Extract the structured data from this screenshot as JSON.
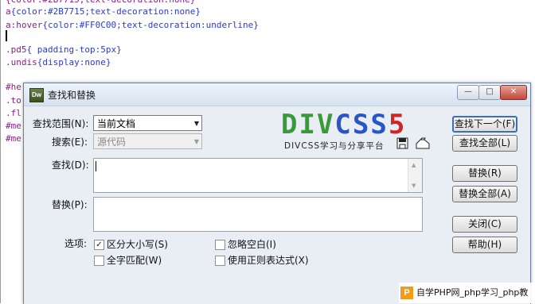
{
  "editor": {
    "lines": [
      {
        "sel": "a",
        "prop": "{color:#2B7715;text-decoration:none}"
      },
      {
        "sel": "a:hover",
        "prop": "{color:#FF0C00;text-decoration:underline}"
      },
      {
        "sel": ".pd5",
        "prop": "{ padding-top:5px}"
      },
      {
        "sel": ".undis",
        "prop": "{display:none}"
      },
      {
        "sel": "#he",
        "prop": ""
      },
      {
        "sel": ".to",
        "prop": ""
      },
      {
        "sel": ".fl",
        "prop": ""
      },
      {
        "sel": "#me",
        "prop": ""
      },
      {
        "sel": "#me",
        "prop": ""
      }
    ]
  },
  "dialog": {
    "title": "查找和替换",
    "app_icon": "Dw",
    "window_controls": {
      "minimize": "—",
      "maximize": "□",
      "close": "✕"
    },
    "scope": {
      "label": "查找范围(N):",
      "value": "当前文档"
    },
    "search": {
      "label": "搜索(E):",
      "value": "源代码"
    },
    "find": {
      "label": "查找(D):",
      "value": ""
    },
    "replace": {
      "label": "替换(P):",
      "value": ""
    },
    "options": {
      "label": "选项:",
      "match_case": {
        "label": "区分大小写(S)",
        "checked": true
      },
      "ignore_whitespace": {
        "label": "忽略空白(I)",
        "checked": false
      },
      "match_whole_word": {
        "label": "全字匹配(W)",
        "checked": false
      },
      "use_regex": {
        "label": "使用正则表达式(X)",
        "checked": false
      }
    },
    "buttons": {
      "find_next": "查找下一个(F)",
      "find_all": "查找全部(L)",
      "replace": "替换(R)",
      "replace_all": "替换全部(A)",
      "close": "关闭(C)",
      "help": "帮助(H)"
    }
  },
  "watermark": {
    "logo_div": "DIV",
    "logo_css": "CSS",
    "logo_5": "5",
    "subtitle": "DIVCSS学习与分享平台",
    "colors": {
      "div": "#3a9a3a",
      "css": "#2a55c8",
      "five": "#d42424"
    }
  },
  "site_badge": {
    "logo": "P",
    "text": "自学PHP网_php学习_php教"
  },
  "icons": {
    "save": "save-icon",
    "load": "load-query-icon"
  }
}
